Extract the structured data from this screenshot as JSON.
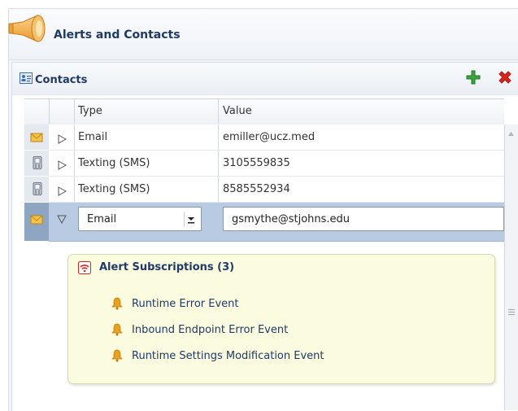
{
  "header": {
    "title": "Alerts and Contacts"
  },
  "contacts": {
    "title": "Contacts",
    "columns": [
      "Type",
      "Value"
    ],
    "rows": [
      {
        "icon": "email-envelope-icon",
        "type": "Email",
        "value": "emiller@ucz.med"
      },
      {
        "icon": "mobile-phone-icon",
        "type": "Texting (SMS)",
        "value": "3105559835"
      },
      {
        "icon": "mobile-phone-icon",
        "type": "Texting (SMS)",
        "value": "8585552934"
      }
    ],
    "selected_row": {
      "icon": "email-envelope-icon",
      "type_select_value": "Email",
      "value_input": "gsmythe@stjohns.edu"
    }
  },
  "alerts": {
    "title": "Alert Subscriptions (3)",
    "events": [
      "Runtime Error Event",
      "Inbound Endpoint Error Event",
      "Runtime Settings Modification Event"
    ]
  },
  "colors": {
    "title_text": "#1f3a68",
    "selected_row": "#b9cbe2",
    "alerts_bg": "#fbfbe0",
    "add_icon": "#3aa53a",
    "delete_icon": "#d9261c"
  }
}
